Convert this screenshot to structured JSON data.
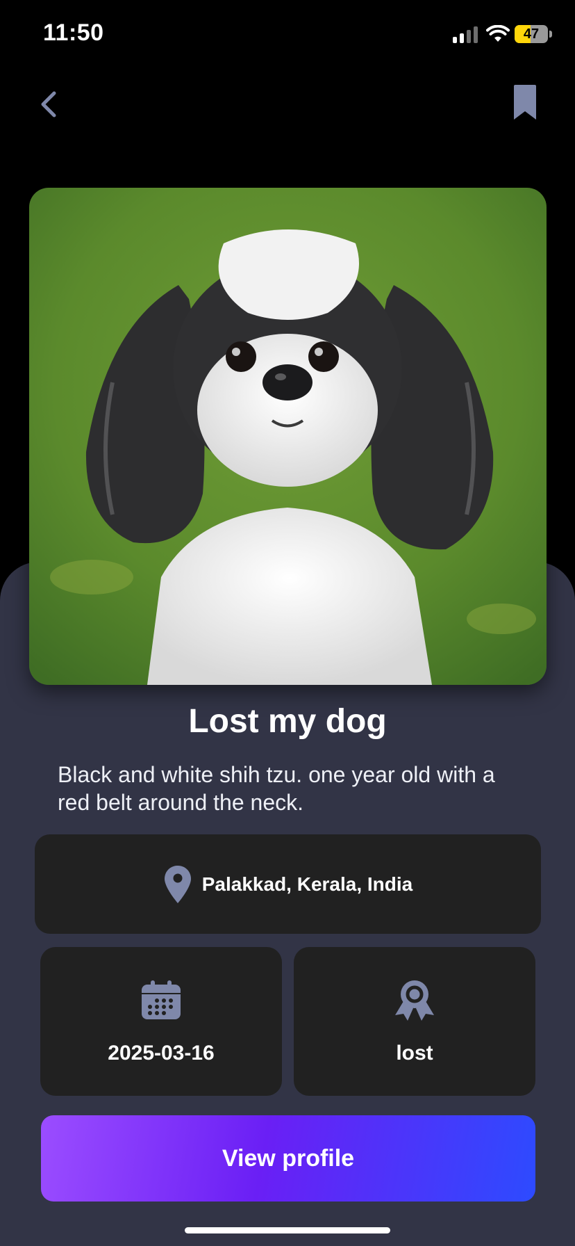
{
  "status_bar": {
    "time": "11:50",
    "battery_level": "47",
    "signal_icon": "signal-icon",
    "wifi_icon": "wifi-icon"
  },
  "nav": {
    "back_icon": "chevron-left-icon",
    "bookmark_icon": "bookmark-icon"
  },
  "post": {
    "photo_alt": "Black and white shih tzu",
    "title": "Lost my dog",
    "description": "Black and white shih tzu. one year old with a red belt around the neck.",
    "location": "Palakkad, Kerala, India",
    "date": "2025-03-16",
    "status": "lost"
  },
  "actions": {
    "view_profile_label": "View profile"
  },
  "colors": {
    "panel": "#323446",
    "card": "#212121",
    "icon": "#7f88aa",
    "accent_start": "#9b4dff",
    "accent_end": "#2d4bff"
  }
}
